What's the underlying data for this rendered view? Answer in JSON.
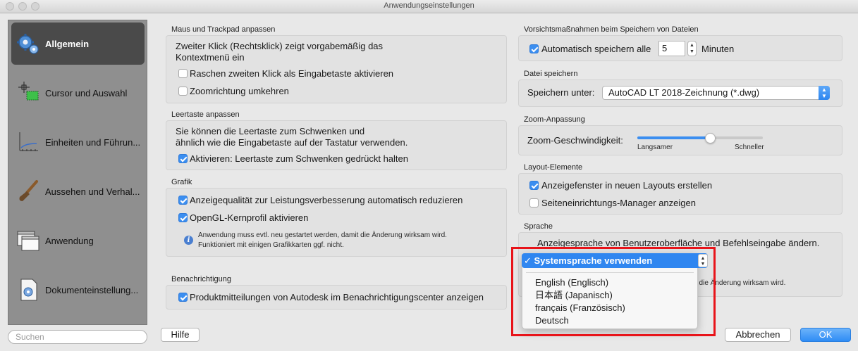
{
  "window": {
    "title": "Anwendungseinstellungen"
  },
  "sidebar": {
    "items": [
      {
        "label": "Allgemein",
        "icon": "gears-icon",
        "selected": true
      },
      {
        "label": "Cursor und Auswahl",
        "icon": "cursor-selection-icon"
      },
      {
        "label": "Einheiten und Führun...",
        "icon": "units-guides-icon"
      },
      {
        "label": "Aussehen und Verhal...",
        "icon": "paintbrush-icon"
      },
      {
        "label": "Anwendung",
        "icon": "windows-icon"
      },
      {
        "label": "Dokumenteinstellung...",
        "icon": "document-settings-icon"
      }
    ],
    "search_placeholder": "Suchen"
  },
  "left": {
    "mouse": {
      "title": "Maus und Trackpad anpassen",
      "desc_line1": "Zweiter Klick (Rechtsklick) zeigt vorgabemäßig das",
      "desc_line2": "Kontextmenü ein",
      "options": [
        {
          "label": "Raschen zweiten Klick als Eingabetaste aktivieren",
          "checked": false
        },
        {
          "label": "Zoomrichtung umkehren",
          "checked": false
        }
      ]
    },
    "space": {
      "title": "Leertaste anpassen",
      "desc_line1": "Sie können die Leertaste zum Schwenken und",
      "desc_line2": "ähnlich wie die Eingabetaste auf der Tastatur verwenden.",
      "option": {
        "label": "Aktivieren: Leertaste zum Schwenken gedrückt halten",
        "checked": true
      }
    },
    "graphics": {
      "title": "Grafik",
      "options": [
        {
          "label": "Anzeigequalität zur Leistungsverbesserung automatisch reduzieren",
          "checked": true
        },
        {
          "label": "OpenGL-Kernprofil aktivieren",
          "checked": true
        }
      ],
      "note_line1": "Anwendung muss evtl. neu gestartet werden, damit die Änderung wirksam wird.",
      "note_line2": "Funktioniert mit einigen Grafikkarten ggf. nicht."
    },
    "notify": {
      "title": "Benachrichtigung",
      "option": {
        "label": "Produktmitteilungen von Autodesk im Benachrichtigungscenter anzeigen",
        "checked": true
      }
    }
  },
  "right": {
    "precautions": {
      "title": "Vorsichtsmaßnahmen beim Speichern von Dateien",
      "autosave_label": "Automatisch speichern alle",
      "autosave_checked": true,
      "autosave_value": "5",
      "minutes_label": "Minuten"
    },
    "save": {
      "title": "Datei speichern",
      "save_as_label": "Speichern unter:",
      "save_as_value": "AutoCAD LT 2018-Zeichnung (*.dwg)"
    },
    "zoom": {
      "title": "Zoom-Anpassung",
      "speed_label": "Zoom-Geschwindigkeit:",
      "speed_fraction": 0.58,
      "min_label": "Langsamer",
      "max_label": "Schneller"
    },
    "layout": {
      "title": "Layout-Elemente",
      "options": [
        {
          "label": "Anzeigefenster in neuen Layouts erstellen",
          "checked": true
        },
        {
          "label": "Seiteneinrichtungs-Manager anzeigen",
          "checked": false
        }
      ]
    },
    "language": {
      "title": "Sprache",
      "desc": "Anzeigesprache von Benutzeroberfläche und Befehlseingabe ändern.",
      "note_partial": "t die Änderung wirksam wird.",
      "selected": "Systemsprache verwenden",
      "options": [
        "English (Englisch)",
        "日本語 (Japanisch)",
        "français (Französisch)",
        "Deutsch"
      ]
    }
  },
  "buttons": {
    "help": "Hilfe",
    "cancel": "Abbrechen",
    "ok": "OK"
  },
  "colors": {
    "accent": "#2f86f0",
    "highlight_box": "#e8141a",
    "sidebar_bg": "#8f8f8f"
  }
}
